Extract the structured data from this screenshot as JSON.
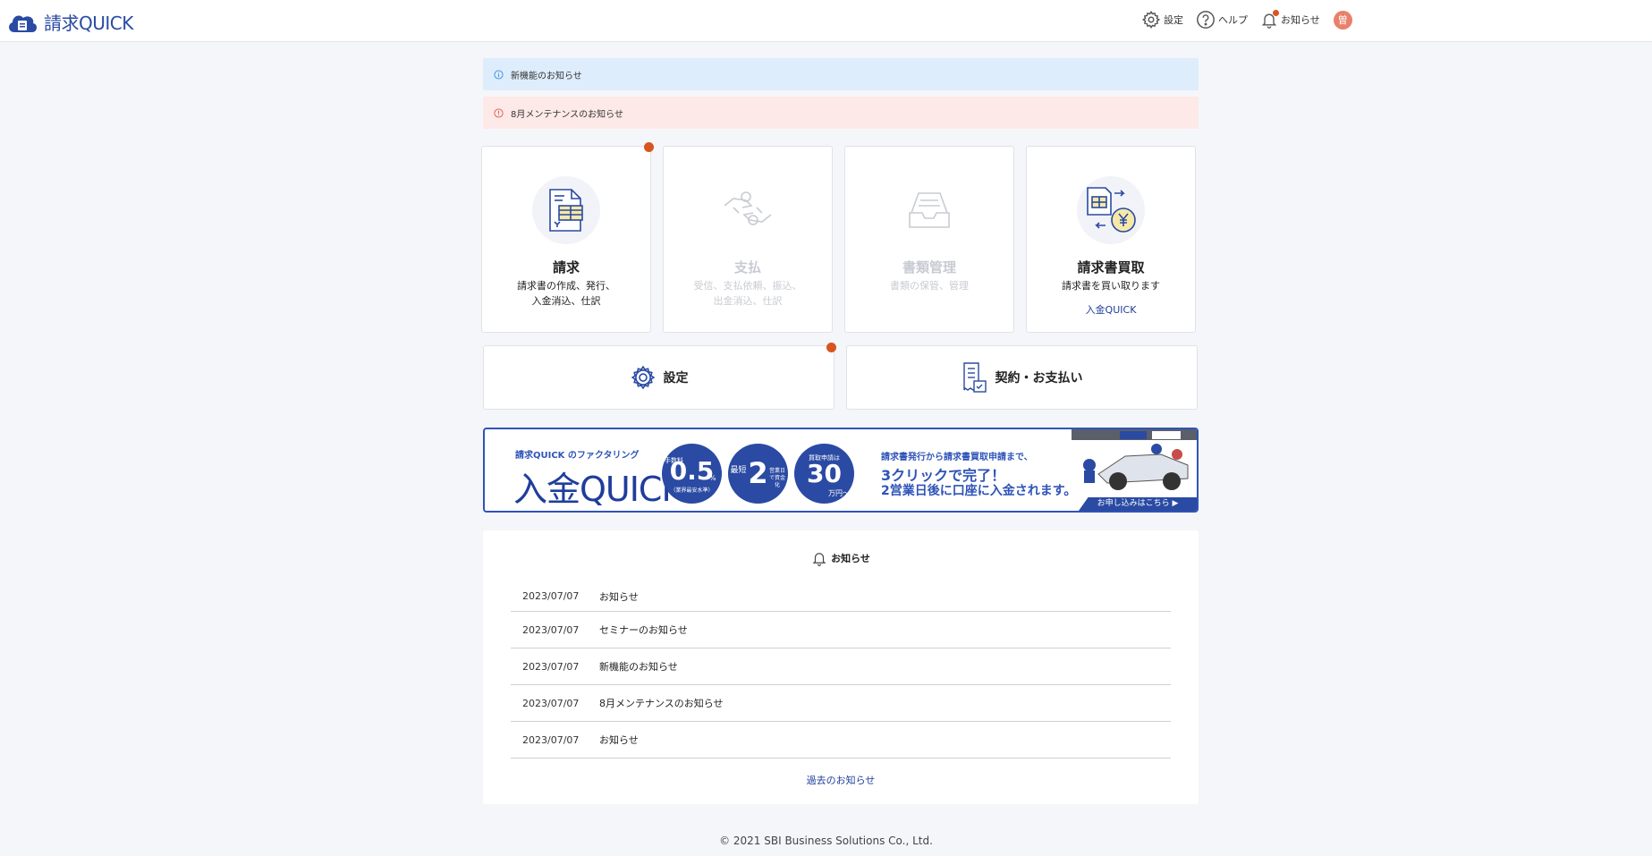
{
  "header": {
    "logo_text": "請求QUICK",
    "nav": {
      "settings": "設定",
      "help": "ヘルプ",
      "notifications": "お知らせ"
    },
    "avatar_initial": "曽"
  },
  "notices": [
    {
      "text": "新機能のお知らせ",
      "kind": "info"
    },
    {
      "text": "8月メンテナンスのお知らせ",
      "kind": "warning"
    }
  ],
  "cards": [
    {
      "title": "請求",
      "desc1": "請求書の作成、発行、",
      "desc2": "入金消込、仕訳",
      "enabled": true
    },
    {
      "title": "支払",
      "desc1": "受信、支払依頼、振込、",
      "desc2": "出金消込、仕訳",
      "enabled": false
    },
    {
      "title": "書類管理",
      "desc1": "書類の保管、管理",
      "desc2": "",
      "enabled": false
    },
    {
      "title": "請求書買取",
      "desc1": "請求書を買い取ります",
      "desc2": "",
      "sub": "入金QUICK",
      "enabled": true
    }
  ],
  "wide_buttons": {
    "settings": "設定",
    "contract": "契約・お支払い"
  },
  "banner": {
    "small": "請求QUICK のファクタリング",
    "big": "入金QUICK",
    "c1_top": "手数料",
    "c1_num": "0.5",
    "c1_unit": "%",
    "c1_note": "（業界最安水準）",
    "c2_pre": "最短",
    "c2_num": "2",
    "c2_post": "営業日で資金化",
    "c3_top": "買取申請は",
    "c3_num": "30",
    "c3_unit": "万円〜",
    "lead": "請求書発行から請求書買取申請まで、",
    "line1": "3クリックで完了！",
    "line2": "2営業日後に口座に入金されます。",
    "apply": "お申し込みはこちら ▶"
  },
  "news": {
    "heading": "お知らせ",
    "items": [
      {
        "date": "2023/07/07",
        "title": "お知らせ"
      },
      {
        "date": "2023/07/07",
        "title": "セミナーのお知らせ"
      },
      {
        "date": "2023/07/07",
        "title": "新機能のお知らせ"
      },
      {
        "date": "2023/07/07",
        "title": "8月メンテナンスのお知らせ"
      },
      {
        "date": "2023/07/07",
        "title": "お知らせ"
      }
    ],
    "more": "過去のお知らせ"
  },
  "footer": "© 2021 SBI Business Solutions Co., Ltd.",
  "colors": {
    "brand": "#2a4aa3",
    "accent_dot": "#d9541e",
    "info_bg": "#deedfc",
    "warn_bg": "#fde9e7"
  }
}
